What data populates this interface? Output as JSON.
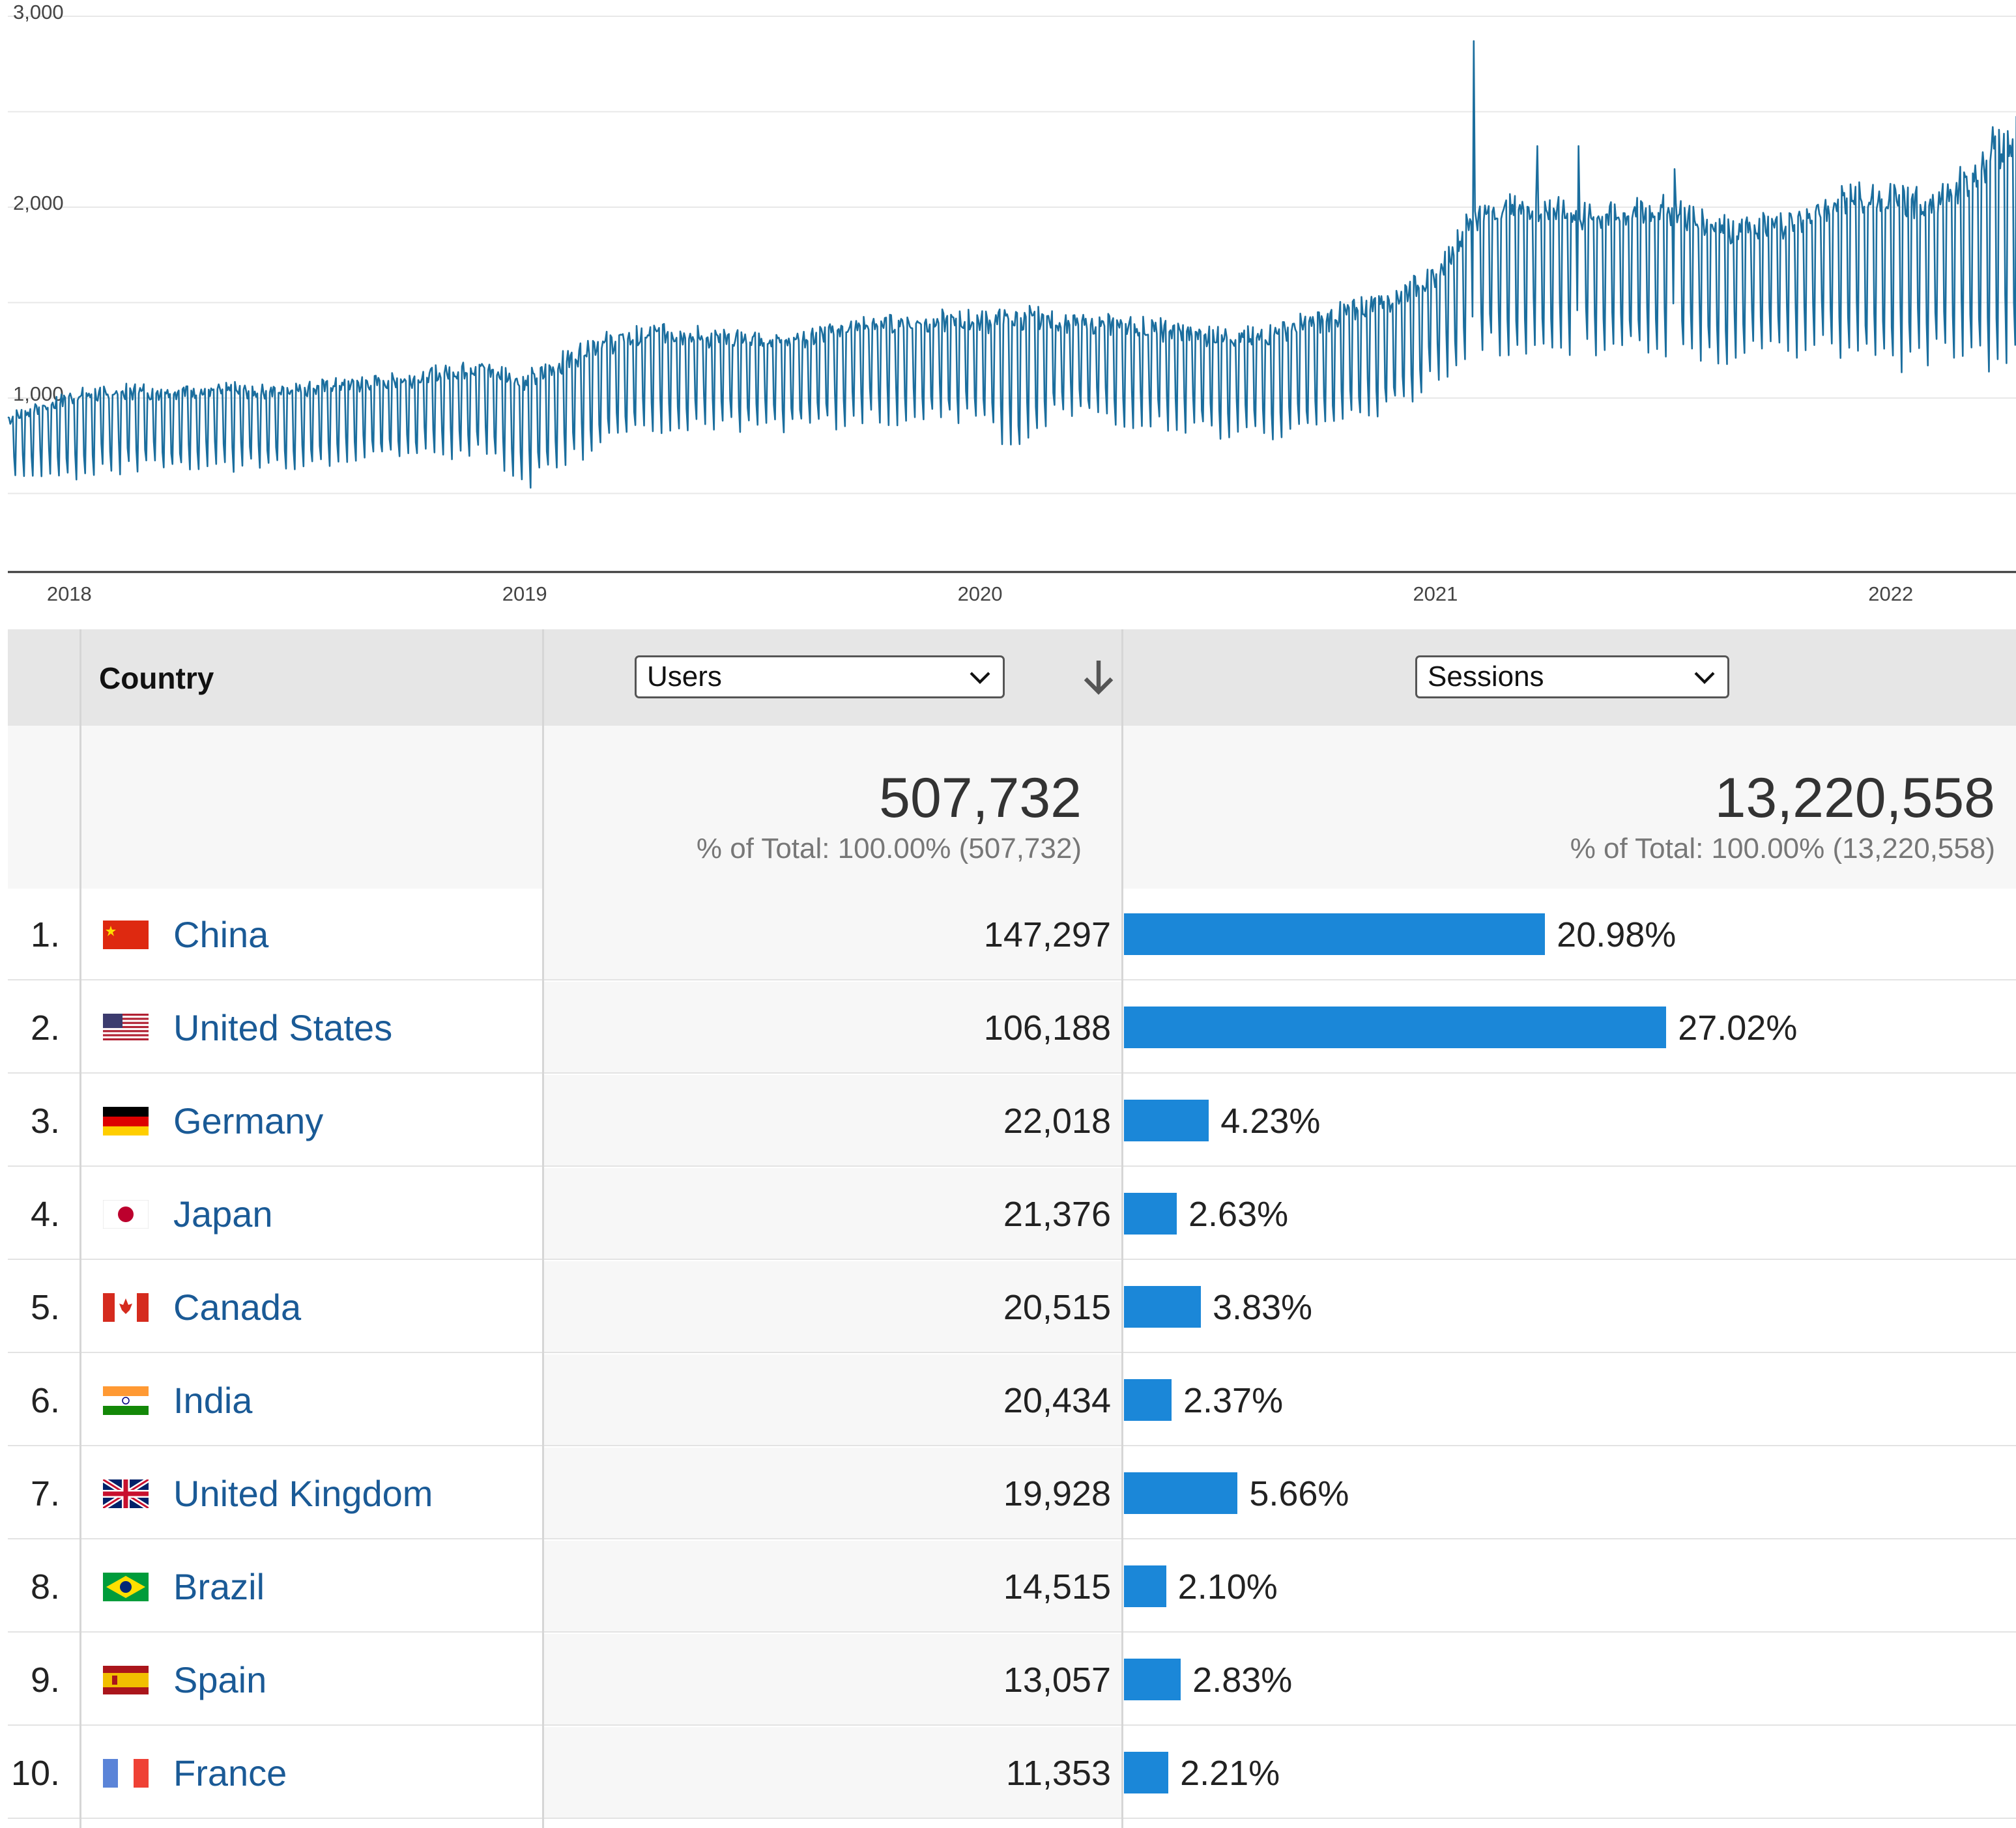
{
  "colors": {
    "line": "#1b6e9e",
    "bar": "#1b87d8",
    "link": "#1a5a96",
    "header_bg": "#e6e6e6",
    "totals_bg": "#f7f7f7"
  },
  "chart_data": {
    "type": "line",
    "y_ticks": [
      "3,000",
      "2,000",
      "1,000"
    ],
    "ylim": [
      0,
      3000
    ],
    "x_ticks": [
      "2018",
      "2019",
      "2020",
      "2021",
      "2022"
    ],
    "x_tick_positions": [
      2018,
      2019,
      2020,
      2021,
      2022
    ],
    "xlim": [
      2017.86,
      2022.27
    ],
    "grid": true,
    "series": [
      {
        "x": [
          2017.86,
          2018.0,
          2018.15,
          2018.3,
          2018.45,
          2018.6,
          2018.75,
          2018.9,
          2019.0,
          2019.15,
          2019.3,
          2019.45,
          2019.6,
          2019.75,
          2019.9,
          2020.0,
          2020.08,
          2020.15,
          2020.3,
          2020.45,
          2020.6,
          2020.75,
          2020.9,
          2021.0,
          2021.08,
          2021.2,
          2021.35,
          2021.5,
          2021.65,
          2021.8,
          2021.9,
          2022.0,
          2022.1,
          2022.27
        ],
        "peak": [
          900,
          1020,
          1050,
          1050,
          1050,
          1080,
          1120,
          1180,
          1100,
          1300,
          1360,
          1320,
          1330,
          1400,
          1420,
          1420,
          1440,
          1420,
          1400,
          1360,
          1330,
          1430,
          1550,
          1660,
          1980,
          2020,
          1970,
          2010,
          1900,
          1960,
          2080,
          2060,
          2040,
          2400
        ],
        "trough": [
          620,
          600,
          650,
          640,
          650,
          680,
          700,
          730,
          560,
          760,
          860,
          860,
          850,
          900,
          900,
          910,
          720,
          930,
          890,
          850,
          810,
          850,
          950,
          1120,
          1280,
          1290,
          1270,
          1280,
          1230,
          1270,
          1270,
          1180,
          1250,
          1200
        ],
        "spikes": [
          {
            "x": 2021.08,
            "y": 2870
          },
          {
            "x": 2021.22,
            "y": 2320
          },
          {
            "x": 2021.31,
            "y": 2320
          },
          {
            "x": 2021.52,
            "y": 2200
          },
          {
            "x": 2022.22,
            "y": 2420
          }
        ]
      }
    ]
  },
  "table": {
    "header": {
      "country": "Country",
      "metric1": "Users",
      "metric2": "Sessions"
    },
    "totals": {
      "users": "507,732",
      "users_pct": "% of Total: 100.00% (507,732)",
      "sessions": "13,220,558",
      "sessions_pct": "% of Total: 100.00% (13,220,558)"
    },
    "rows": [
      {
        "idx": "1.",
        "country": "China",
        "flag": "china-flag-icon",
        "users": "147,297",
        "pct": "20.98%",
        "share": 20.98
      },
      {
        "idx": "2.",
        "country": "United States",
        "flag": "us-flag-icon",
        "users": "106,188",
        "pct": "27.02%",
        "share": 27.02
      },
      {
        "idx": "3.",
        "country": "Germany",
        "flag": "germany-flag-icon",
        "users": "22,018",
        "pct": "4.23%",
        "share": 4.23
      },
      {
        "idx": "4.",
        "country": "Japan",
        "flag": "japan-flag-icon",
        "users": "21,376",
        "pct": "2.63%",
        "share": 2.63
      },
      {
        "idx": "5.",
        "country": "Canada",
        "flag": "canada-flag-icon",
        "users": "20,515",
        "pct": "3.83%",
        "share": 3.83
      },
      {
        "idx": "6.",
        "country": "India",
        "flag": "india-flag-icon",
        "users": "20,434",
        "pct": "2.37%",
        "share": 2.37
      },
      {
        "idx": "7.",
        "country": "United Kingdom",
        "flag": "uk-flag-icon",
        "users": "19,928",
        "pct": "5.66%",
        "share": 5.66
      },
      {
        "idx": "8.",
        "country": "Brazil",
        "flag": "brazil-flag-icon",
        "users": "14,515",
        "pct": "2.10%",
        "share": 2.1
      },
      {
        "idx": "9.",
        "country": "Spain",
        "flag": "spain-flag-icon",
        "users": "13,057",
        "pct": "2.83%",
        "share": 2.83
      },
      {
        "idx": "10.",
        "country": "France",
        "flag": "france-flag-icon",
        "users": "11,353",
        "pct": "2.21%",
        "share": 2.21
      }
    ]
  }
}
